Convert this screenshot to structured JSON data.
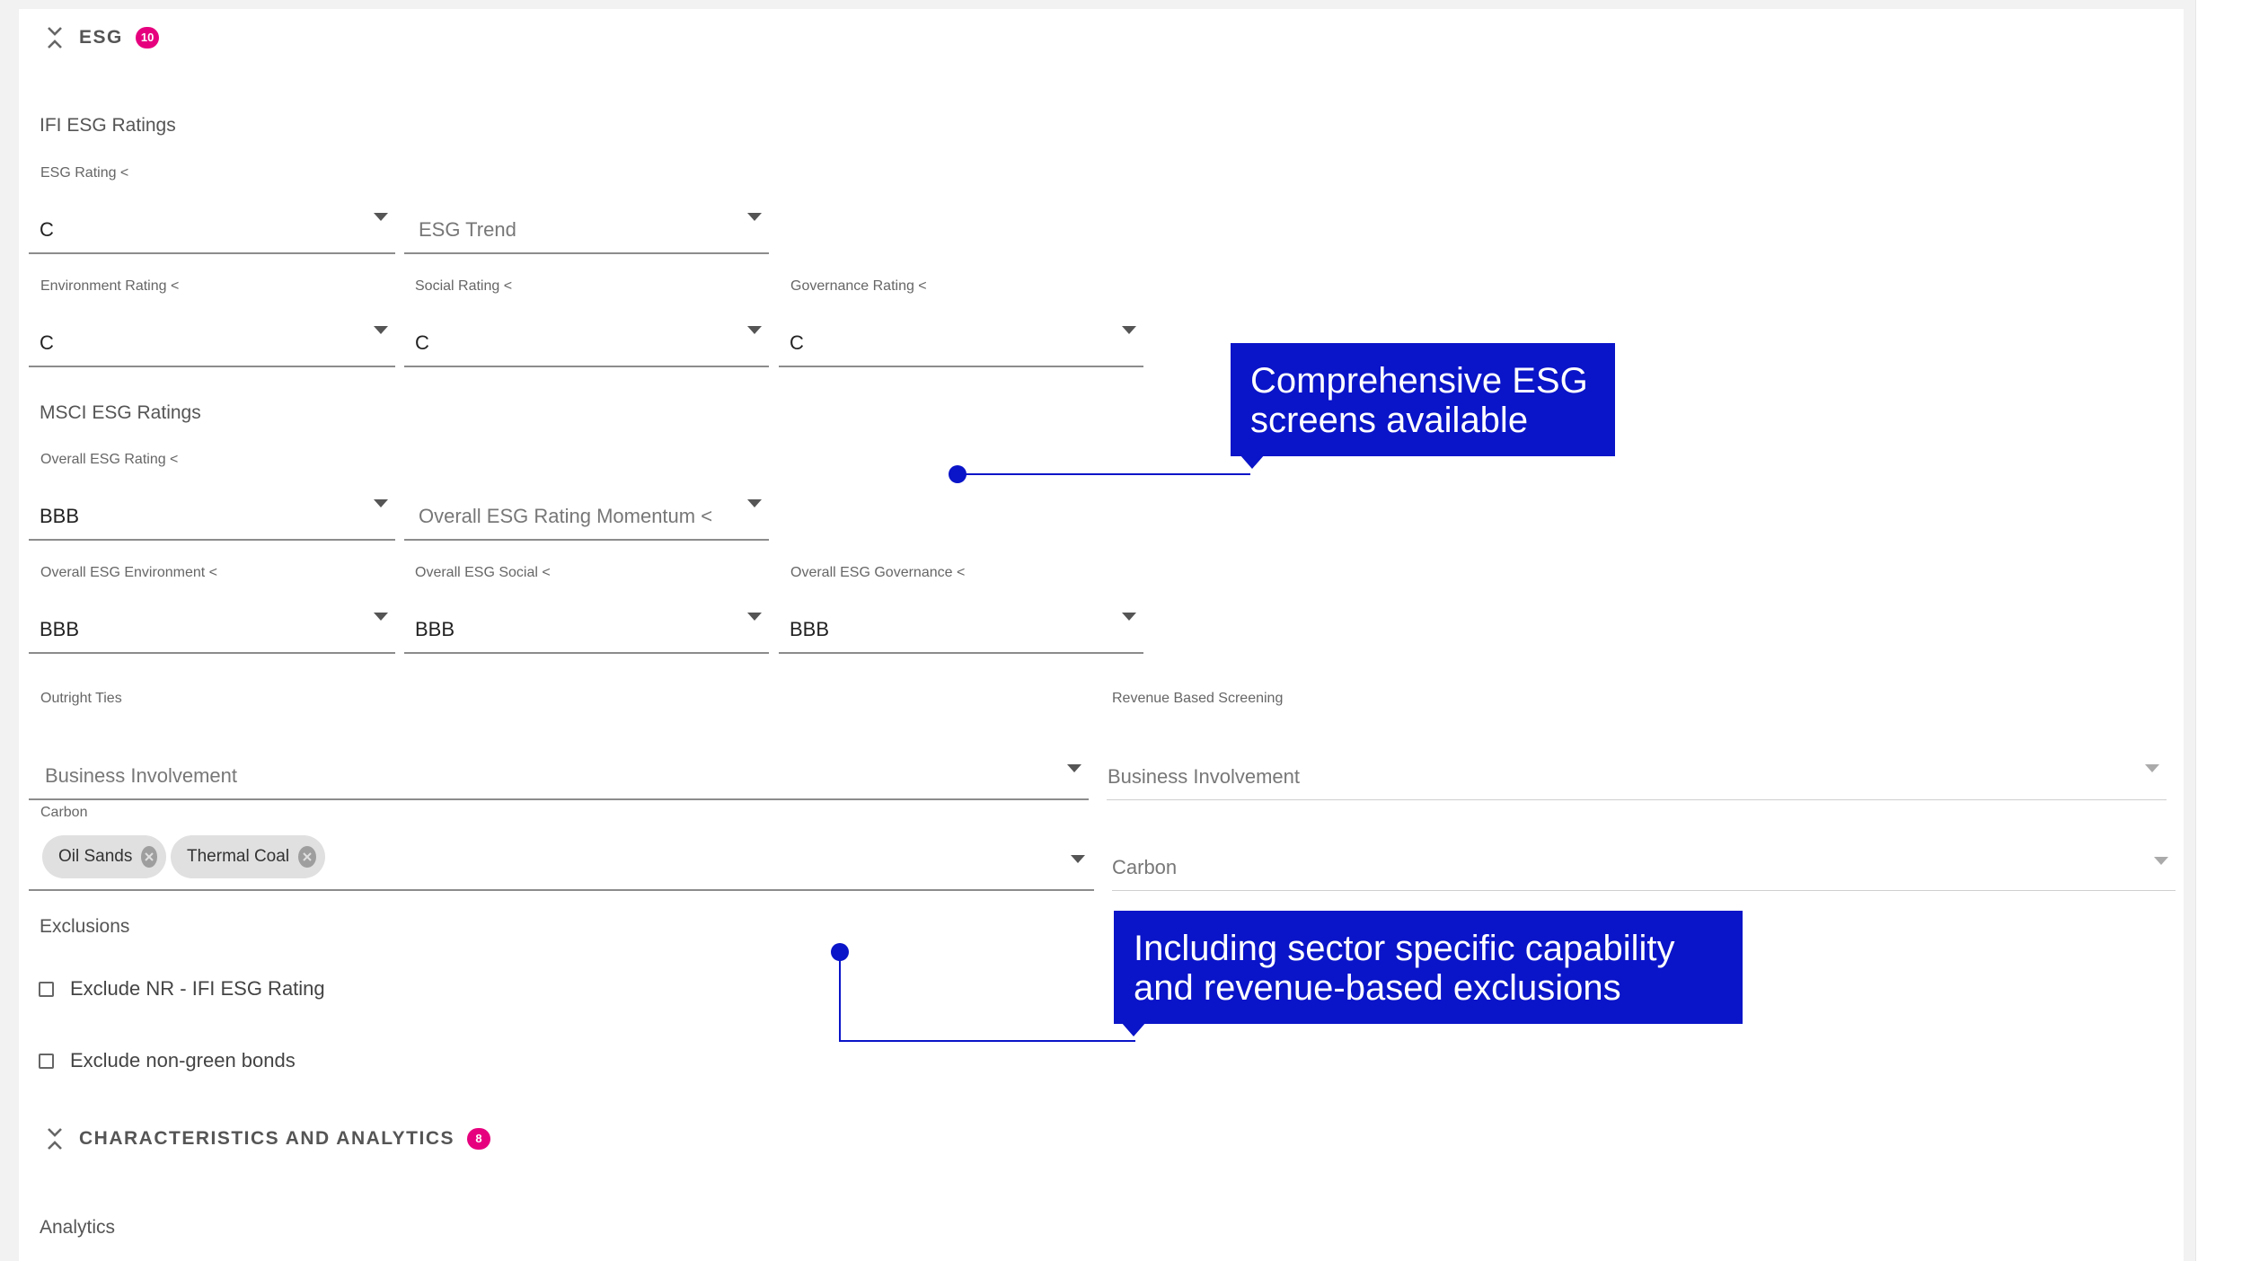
{
  "esg_section": {
    "title": "ESG",
    "badge": "10"
  },
  "ifi": {
    "group_title": "IFI ESG Ratings",
    "esg_rating": {
      "label": "ESG Rating <",
      "value": "C"
    },
    "esg_trend": {
      "placeholder": "ESG Trend"
    },
    "environment_rating": {
      "label": "Environment Rating <",
      "value": "C"
    },
    "social_rating": {
      "label": "Social Rating <",
      "value": "C"
    },
    "governance_rating": {
      "label": "Governance Rating <",
      "value": "C"
    }
  },
  "msci": {
    "group_title": "MSCI ESG Ratings",
    "overall_esg_rating": {
      "label": "Overall ESG Rating <",
      "value": "BBB"
    },
    "overall_esg_momentum": {
      "placeholder": "Overall ESG Rating Momentum <"
    },
    "overall_esg_environment": {
      "label": "Overall ESG Environment <",
      "value": "BBB"
    },
    "overall_esg_social": {
      "label": "Overall ESG Social <",
      "value": "BBB"
    },
    "overall_esg_governance": {
      "label": "Overall ESG Governance <",
      "value": "BBB"
    }
  },
  "outright_ties": {
    "label": "Outright Ties",
    "business_involvement": {
      "placeholder": "Business Involvement"
    },
    "carbon": {
      "label": "Carbon",
      "chips": [
        "Oil Sands",
        "Thermal Coal"
      ]
    }
  },
  "revenue_screening": {
    "label": "Revenue Based Screening",
    "business_involvement": {
      "placeholder": "Business Involvement"
    },
    "carbon": {
      "placeholder": "Carbon"
    }
  },
  "exclusions": {
    "title": "Exclusions",
    "items": [
      {
        "label": "Exclude NR - IFI ESG Rating",
        "checked": false
      },
      {
        "label": "Exclude non-green bonds",
        "checked": false
      }
    ]
  },
  "characteristics_section": {
    "title": "CHARACTERISTICS AND ANALYTICS",
    "badge": "8"
  },
  "analytics": {
    "title": "Analytics"
  },
  "callouts": {
    "first": [
      "Comprehensive ESG",
      "screens available"
    ],
    "second": [
      "Including sector specific capability",
      "and revenue-based exclusions"
    ]
  },
  "colors": {
    "accent_badge": "#e6007e",
    "callout_blue": "#0a14c8"
  },
  "icons": {
    "collapse": "double-chevron-collapse-icon",
    "dropdown": "caret-down-icon",
    "chip_remove": "close-circle-icon"
  }
}
